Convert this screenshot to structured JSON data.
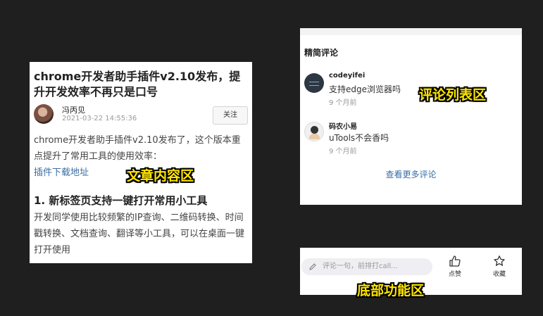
{
  "article": {
    "title": "chrome开发者助手插件v2.10发布，提升开发效率不再只是口号",
    "author_name": "冯丙见",
    "published_time": "2021-03-22 14:55:36",
    "follow_label": "关注",
    "intro": "chrome开发者助手插件v2.10发布了，这个版本重点提升了常用工具的使用效率：",
    "download_link": "插件下载地址",
    "section_heading": "1. 新标签页支持一键打开常用小工具",
    "section_body": "开发同学使用比较频繁的IP查询、二维码转换、时间戳转换、文档查询、翻译等小工具，可以在桌面一键打开使用"
  },
  "comments": {
    "title": "精简评论",
    "items": [
      {
        "user": "codeyifei",
        "text": "支持edge浏览器吗",
        "time": "9 个月前"
      },
      {
        "user": "码农小易",
        "text": "uTools不会香吗",
        "time": "9 个月前"
      }
    ],
    "more_label": "查看更多评论"
  },
  "bottom_bar": {
    "input_placeholder": "评论一句，前排打call...",
    "like_label": "点赞",
    "favorite_label": "收藏"
  },
  "overlays": {
    "article_area": "文章内容区",
    "comments_area": "评论列表区",
    "bottom_area": "底部功能区"
  },
  "icons": {
    "edit": "pencil-icon",
    "like": "thumbs-up-icon",
    "favorite": "star-icon"
  },
  "colors": {
    "background": "#1f1f1f",
    "overlay_text": "#ffe600",
    "link": "#3a6ea5"
  }
}
